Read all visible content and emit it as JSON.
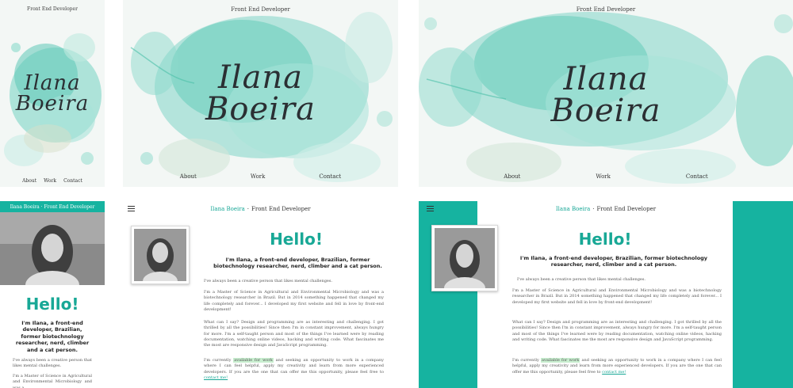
{
  "hero": {
    "top_title": "Front End Developer",
    "name_line1": "Ilana",
    "name_line2": "Boeira",
    "nav": [
      "About",
      "Work",
      "Contact"
    ]
  },
  "about": {
    "header_brand": "Ilana Boeira",
    "header_sep": "·",
    "header_role": "Front End Developer",
    "mobile_header": "Ilana Boeira · Front End Developer",
    "hello": "Hello!",
    "intro": "I'm Ilana, a front-end developer, Brazilian, former biotechnology researcher, nerd, climber and a cat person.",
    "p1": "I've always been a creative person that likes mental challenges.",
    "p2": "I'm a Master of Science in Agricultural and Environmental Microbiology and was a biotechnology researcher in Brazil. But in 2014 something happened that changed my life completely and forever... I developed my first website and fell in love by front-end development!",
    "p3": "What can I say? Design and programming are as interesting and challenging. I got thrilled by all the possibilities! Since then I'm in constant improvement, always hungry for more. I'm a self-taught person and most of the things I've learned were by reading documentation, watching online videos, hacking and writing code. What fascinates me the most are responsive design and JavaScript programming.",
    "p4_pre": "I'm currently ",
    "p4_hl": "available for work",
    "p4_mid": " and seeking an opportunity to work in a company where I can feel helpful, apply my creativity and learn from more experienced developers. If you are the one that can offer me this opportunity, please feel free to ",
    "p4_link": "contact me!",
    "mobile_p1": "I've always been a creative person that likes mental challenges.",
    "mobile_p2": "I'm a Master of Science in Agricultural and Environmental Microbiology and was a"
  },
  "colors": {
    "teal": "#16b3a0",
    "teal_text": "#18a896",
    "highlight": "#c8eecf"
  }
}
